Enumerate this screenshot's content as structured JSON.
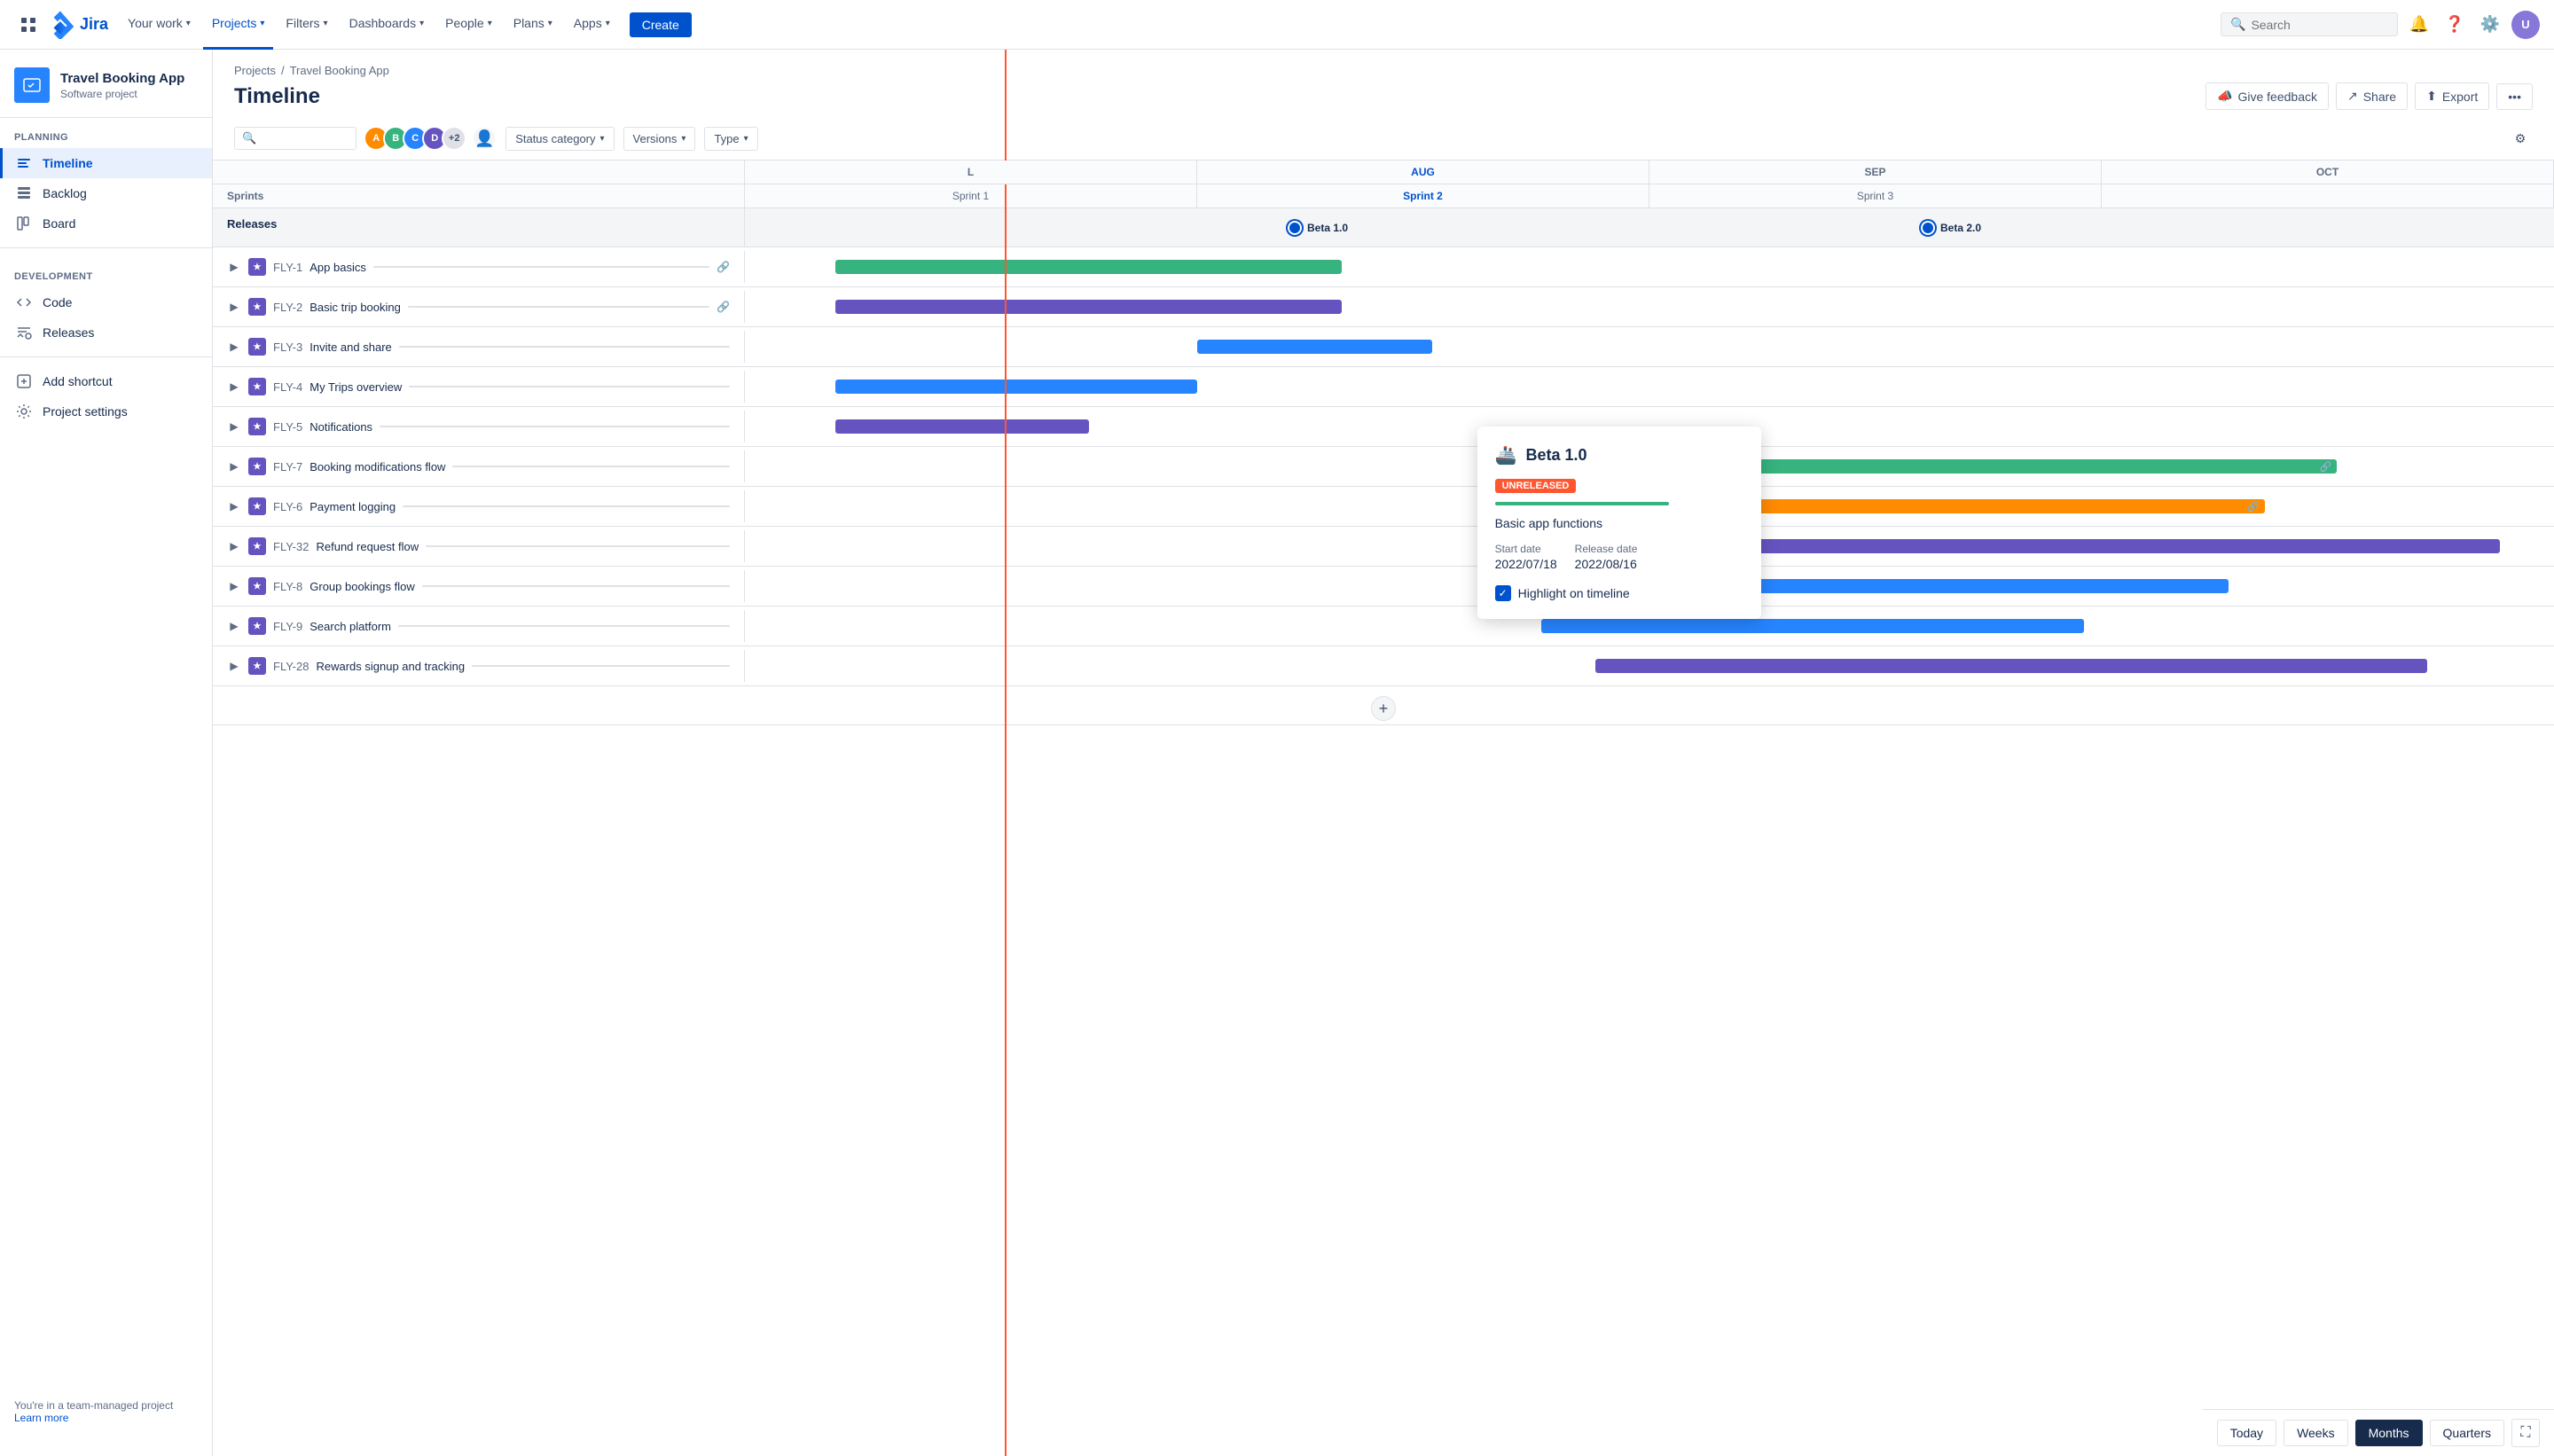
{
  "app": {
    "name": "Jira",
    "logo_text": "Jira"
  },
  "topnav": {
    "items": [
      {
        "id": "your-work",
        "label": "Your work",
        "has_dropdown": true,
        "active": false
      },
      {
        "id": "projects",
        "label": "Projects",
        "has_dropdown": true,
        "active": true
      },
      {
        "id": "filters",
        "label": "Filters",
        "has_dropdown": true,
        "active": false
      },
      {
        "id": "dashboards",
        "label": "Dashboards",
        "has_dropdown": true,
        "active": false
      },
      {
        "id": "people",
        "label": "People",
        "has_dropdown": true,
        "active": false
      },
      {
        "id": "plans",
        "label": "Plans",
        "has_dropdown": true,
        "active": false
      },
      {
        "id": "apps",
        "label": "Apps",
        "has_dropdown": true,
        "active": false
      }
    ],
    "create_label": "Create",
    "search_placeholder": "Search"
  },
  "sidebar": {
    "project_name": "Travel Booking App",
    "project_type": "Software project",
    "planning_label": "PLANNING",
    "development_label": "DEVELOPMENT",
    "items_planning": [
      {
        "id": "timeline",
        "label": "Timeline",
        "active": true
      },
      {
        "id": "backlog",
        "label": "Backlog",
        "active": false
      },
      {
        "id": "board",
        "label": "Board",
        "active": false
      }
    ],
    "items_development": [
      {
        "id": "code",
        "label": "Code",
        "active": false
      },
      {
        "id": "releases",
        "label": "Releases",
        "active": false
      }
    ],
    "add_shortcut": "Add shortcut",
    "project_settings": "Project settings",
    "team_label": "You're in a team-managed project",
    "learn_more": "Learn more"
  },
  "breadcrumb": {
    "items": [
      {
        "label": "Projects",
        "href": "#"
      },
      {
        "label": "Travel Booking App",
        "href": "#"
      }
    ]
  },
  "page": {
    "title": "Timeline"
  },
  "header_actions": [
    {
      "id": "feedback",
      "label": "Give feedback",
      "icon": "megaphone"
    },
    {
      "id": "share",
      "label": "Share",
      "icon": "share"
    },
    {
      "id": "export",
      "label": "Export",
      "icon": "export"
    },
    {
      "id": "more",
      "label": "...",
      "icon": "more"
    }
  ],
  "filters": {
    "status_category": "Status category",
    "versions": "Versions",
    "type": "Type"
  },
  "timeline": {
    "months": [
      {
        "label": "L",
        "current": false
      },
      {
        "label": "AUG",
        "current": true
      },
      {
        "label": "SEP",
        "current": false
      },
      {
        "label": "OCT",
        "current": false
      }
    ],
    "sprints_label": "Sprints",
    "sprint_cells": [
      {
        "label": "Sprint 1"
      },
      {
        "label": "Sprint 2",
        "active": true
      },
      {
        "label": "Sprint 3"
      }
    ],
    "releases_label": "Releases",
    "releases": [
      {
        "id": "beta1",
        "label": "Beta 1.0",
        "position_pct": 30
      },
      {
        "id": "beta2",
        "label": "Beta 2.0",
        "position_pct": 65
      }
    ],
    "epics": [
      {
        "id": "FLY-1",
        "name": "App basics",
        "color": "#36b37e",
        "bar_left_pct": 5,
        "bar_width_pct": 20
      },
      {
        "id": "FLY-2",
        "name": "Basic trip booking",
        "color": "#6554c0",
        "bar_left_pct": 5,
        "bar_width_pct": 20
      },
      {
        "id": "FLY-3",
        "name": "Invite and share",
        "color": "#2684ff",
        "bar_left_pct": 22,
        "bar_width_pct": 10
      },
      {
        "id": "FLY-4",
        "name": "My Trips overview",
        "color": "#2684ff",
        "bar_left_pct": 5,
        "bar_width_pct": 18
      },
      {
        "id": "FLY-5",
        "name": "Notifications",
        "color": "#6554c0",
        "bar_left_pct": 5,
        "bar_width_pct": 12
      },
      {
        "id": "FLY-7",
        "name": "Booking modifications flow",
        "color": "#36b37e",
        "bar_left_pct": 40,
        "bar_width_pct": 28
      },
      {
        "id": "FLY-6",
        "name": "Payment logging",
        "color": "#ff8b00",
        "bar_left_pct": 40,
        "bar_width_pct": 28
      },
      {
        "id": "FLY-32",
        "name": "Refund request flow",
        "color": "#6554c0",
        "bar_left_pct": 45,
        "bar_width_pct": 30
      },
      {
        "id": "FLY-8",
        "name": "Group bookings flow",
        "color": "#2684ff",
        "bar_left_pct": 42,
        "bar_width_pct": 26
      },
      {
        "id": "FLY-9",
        "name": "Search platform",
        "color": "#2684ff",
        "bar_left_pct": 42,
        "bar_width_pct": 20
      },
      {
        "id": "FLY-28",
        "name": "Rewards signup and tracking",
        "color": "#6554c0",
        "bar_left_pct": 45,
        "bar_width_pct": 28
      }
    ]
  },
  "popup": {
    "title": "Beta 1.0",
    "badge": "UNRELEASED",
    "description": "Basic app functions",
    "start_date_label": "Start date",
    "start_date": "2022/07/18",
    "release_date_label": "Release date",
    "release_date": "2022/08/16",
    "highlight_label": "Highlight on timeline"
  },
  "bottom_bar": {
    "today_label": "Today",
    "weeks_label": "Weeks",
    "months_label": "Months",
    "quarters_label": "Quarters"
  }
}
